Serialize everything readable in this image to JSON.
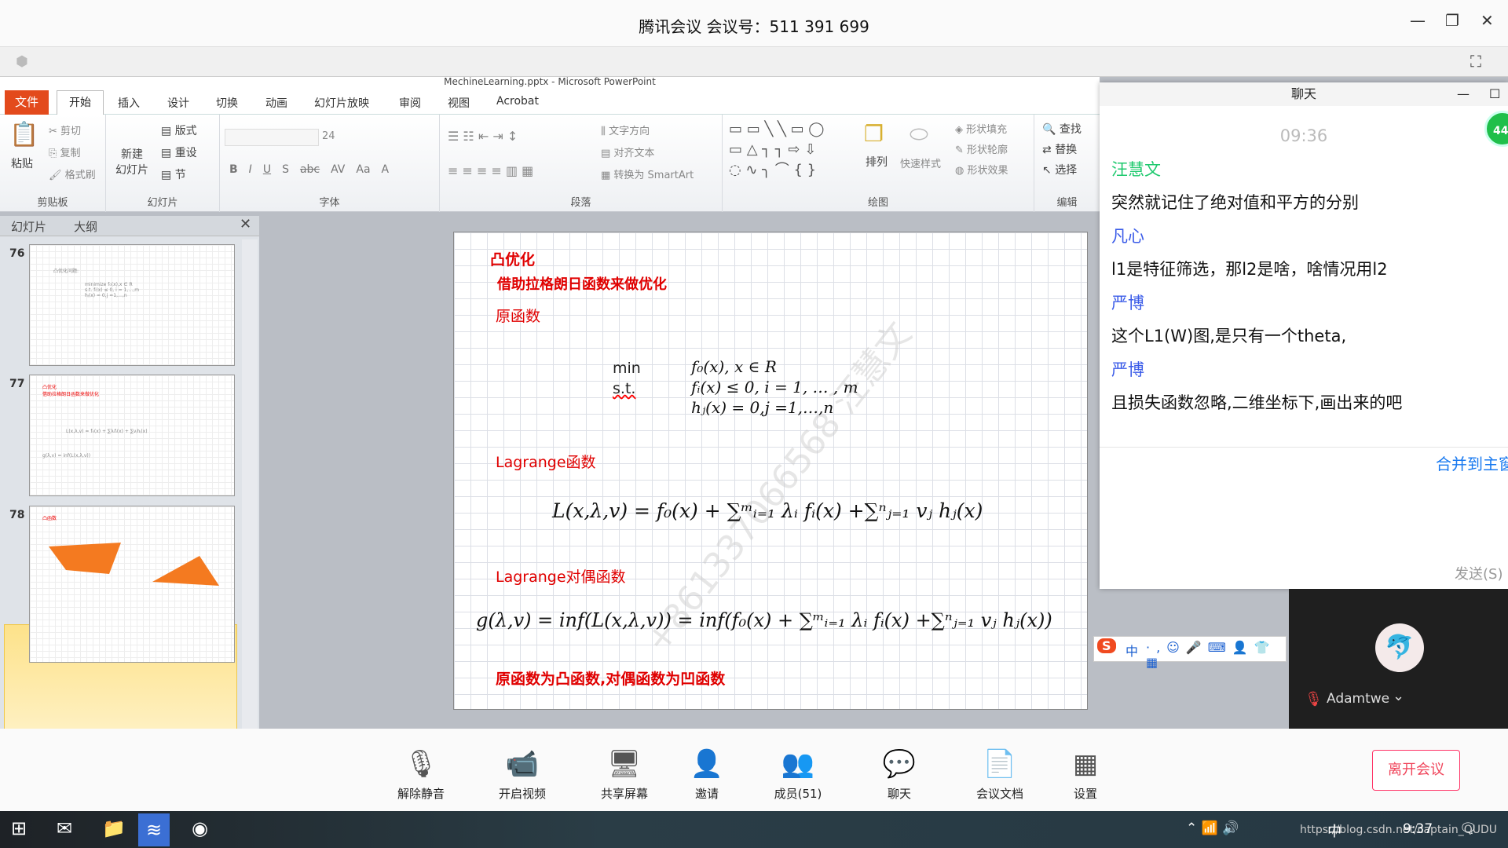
{
  "window": {
    "title": "腾讯会议 会议号：511 391 699",
    "minimize": "—",
    "restore": "❐",
    "close": "✕"
  },
  "ppt": {
    "title": "MechineLearning.pptx - Microsoft PowerPoint",
    "tabs": [
      "文件",
      "开始",
      "插入",
      "设计",
      "切换",
      "动画",
      "幻灯片放映",
      "审阅",
      "视图",
      "Acrobat"
    ],
    "clipboard": {
      "label": "剪贴板",
      "paste": "粘贴",
      "cut": "剪切",
      "copy": "复制",
      "format_painter": "格式刷"
    },
    "slides_group": {
      "label": "幻灯片",
      "new_slide": "新建\n幻灯片",
      "layout": "版式",
      "reset": "重设",
      "section": "节"
    },
    "font": {
      "label": "字体",
      "size": "24",
      "buttons": [
        "B",
        "I",
        "U",
        "S",
        "abc",
        "AV",
        "Aa",
        "A"
      ]
    },
    "paragraph": {
      "label": "段落",
      "text_direction": "文字方向",
      "align_text": "对齐文本",
      "smartart": "转换为 SmartArt"
    },
    "drawing": {
      "label": "绘图",
      "arrange": "排列",
      "quick_styles": "快速样式",
      "fill": "形状填充",
      "outline": "形状轮廓",
      "effects": "形状效果"
    },
    "editing": {
      "label": "编辑",
      "find": "查找",
      "replace": "替换",
      "select": "选择"
    },
    "panel_tabs": [
      "幻灯片",
      "大纲"
    ],
    "thumbnails": [
      {
        "num": "76",
        "lines": [
          "凸优化问题:",
          "minimize  f₀(x),x ∈ R",
          "s.t.  fᵢ(x) ≤ 0, i = 1,…,m",
          "hⱼ(x) = 0,j =1,…,n"
        ]
      },
      {
        "num": "77",
        "lines": [
          "凸优化",
          "借助拉格朗日函数来做优化",
          "L(x,λ,v) = f₀(x) + ∑λᵢfᵢ(x) + ∑vⱼhⱼ(x)",
          "g(λ,v) = inf(L(x,λ,v))"
        ]
      },
      {
        "num": "78",
        "lines": [
          "凸函数"
        ]
      }
    ],
    "slide": {
      "title": "凸优化",
      "subtitle": "借助拉格朗日函数来做优化",
      "primal_label": "原函数",
      "min": "min",
      "st": "s.t.",
      "obj": "f₀(x), x ∈ R",
      "ineq": "fᵢ(x) ≤ 0, i = 1, … , m",
      "eq": "hⱼ(x) = 0,j =1,…,n",
      "lagrange_label": "Lagrange函数",
      "lagrange": "L(x,λ,v) = f₀(x) + ∑ᵐᵢ₌₁ λᵢ fᵢ(x) +∑ⁿⱼ₌₁ vⱼ hⱼ(x)",
      "dual_label": "Lagrange对偶函数",
      "dual": "g(λ,v) = inf(L(x,λ,v)) = inf(f₀(x) + ∑ᵐᵢ₌₁ λᵢ fᵢ(x) +∑ⁿⱼ₌₁ vⱼ hⱼ(x))",
      "conclusion": "原函数为凸函数,对偶函数为凹函数",
      "watermark": "+861337066568 汪慧文"
    }
  },
  "chat": {
    "title": "聊天",
    "time": "09:36",
    "badge": "44",
    "messages": [
      {
        "name": "汪慧文",
        "text": "突然就记住了绝对值和平方的分别",
        "color": "#1ec96e"
      },
      {
        "name": "凡心",
        "text": "l1是特征筛选，那l2是啥，啥情况用l2",
        "color": "#3a5be8"
      },
      {
        "name": "严博",
        "text": "这个L1(W)图,是只有一个theta,",
        "color": "#3a5be8"
      },
      {
        "name": "严博",
        "text": "且损失函数忽略,二维坐标下,画出来的吧",
        "color": "#3a5be8"
      }
    ],
    "merge": "合并到主窗",
    "send": "发送(S)"
  },
  "video": {
    "name": "Adamtwe"
  },
  "ime": {
    "mode": "中"
  },
  "toolbar": [
    {
      "label": "解除静音",
      "icon": "mic-muted-icon",
      "glyph": "🎙"
    },
    {
      "label": "开启视频",
      "icon": "camera-off-icon",
      "glyph": "📹"
    },
    {
      "label": "共享屏幕",
      "icon": "share-screen-icon",
      "glyph": "🖥"
    },
    {
      "label": "邀请",
      "icon": "invite-icon",
      "glyph": "👤"
    },
    {
      "label": "成员(51)",
      "icon": "members-icon",
      "glyph": "👥"
    },
    {
      "label": "聊天",
      "icon": "chat-icon",
      "glyph": "💬"
    },
    {
      "label": "会议文档",
      "icon": "document-icon",
      "glyph": "📄"
    },
    {
      "label": "设置",
      "icon": "settings-icon",
      "glyph": "▦"
    }
  ],
  "leave": "离开会议",
  "taskbar": {
    "time": "9:37",
    "ime": "中",
    "watermark": "https://blog.csdn.net/captain_QUDU"
  },
  "colors": {
    "accent_green": "#1ec96e",
    "leave_red": "#f0445a",
    "slide_red": "#e00000",
    "ppt_file_tab": "#e34a1c"
  }
}
